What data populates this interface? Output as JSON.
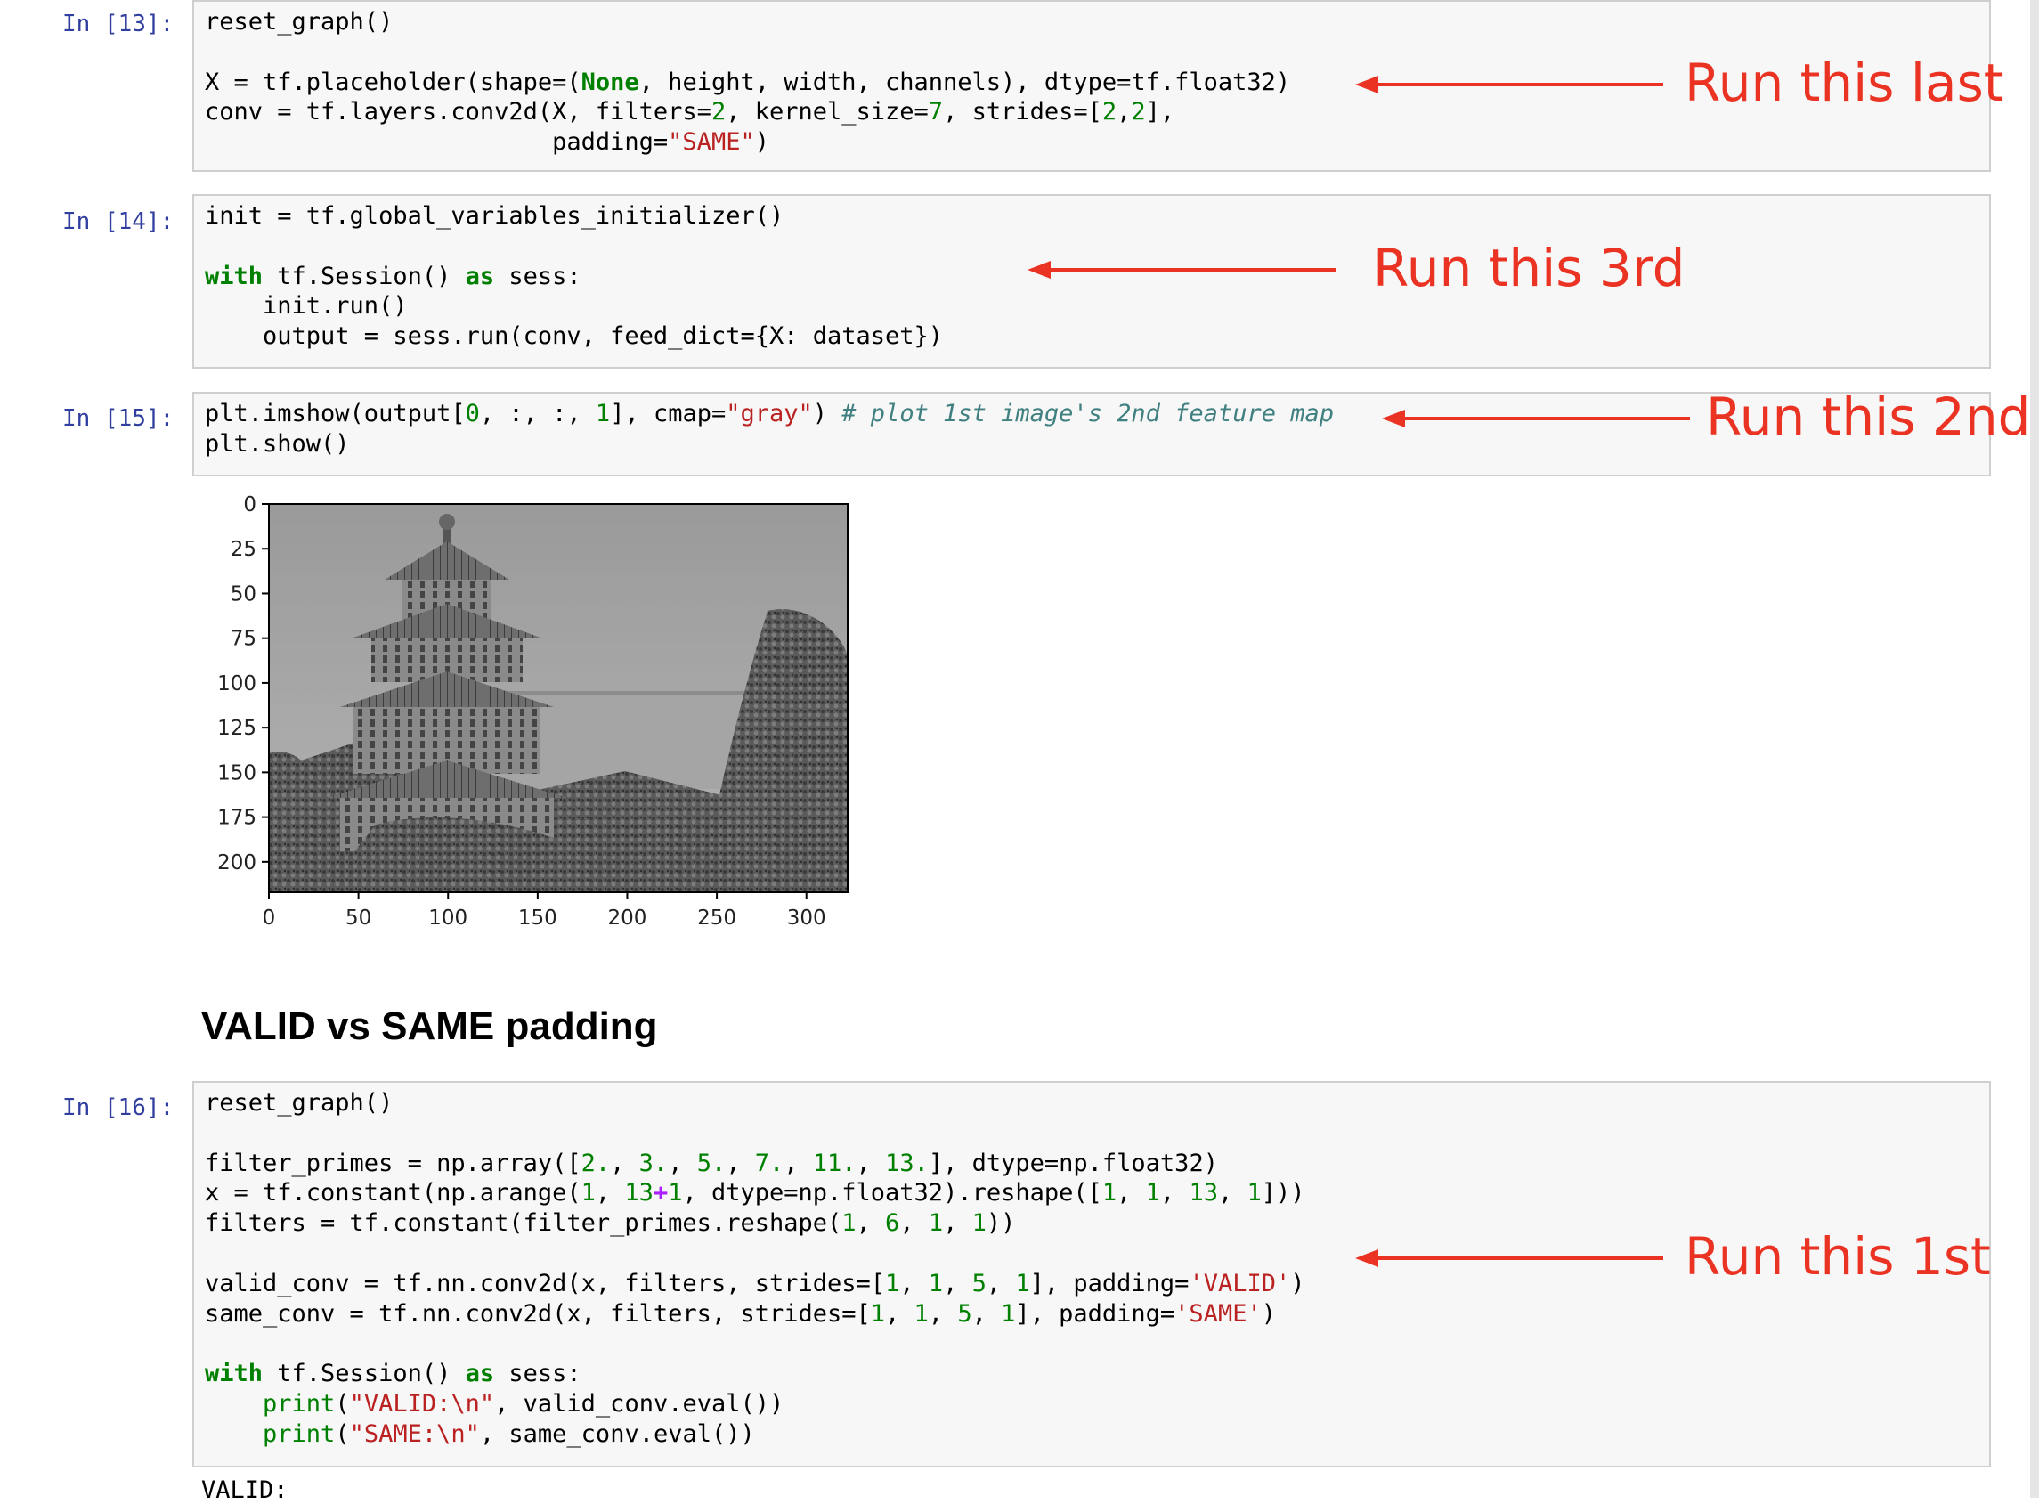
{
  "cells": [
    {
      "prompt": "In [13]:",
      "lines": [
        [
          {
            "t": "reset_graph()"
          }
        ],
        [],
        [
          {
            "t": "X = tf.placeholder(shape=("
          },
          {
            "t": "None",
            "c": "kw"
          },
          {
            "t": ", height, width, channels), dtype=tf.float32)"
          }
        ],
        [
          {
            "t": "conv = tf.layers.conv2d(X, filters="
          },
          {
            "t": "2",
            "c": "num"
          },
          {
            "t": ", kernel_size="
          },
          {
            "t": "7",
            "c": "num"
          },
          {
            "t": ", strides=["
          },
          {
            "t": "2",
            "c": "num"
          },
          {
            "t": ","
          },
          {
            "t": "2",
            "c": "num"
          },
          {
            "t": "],"
          }
        ],
        [
          {
            "t": "                        padding="
          },
          {
            "t": "\"SAME\"",
            "c": "str"
          },
          {
            "t": ")"
          }
        ]
      ]
    },
    {
      "prompt": "In [14]:",
      "lines": [
        [
          {
            "t": "init = tf.global_variables_initializer()"
          }
        ],
        [],
        [
          {
            "t": "with",
            "c": "kw"
          },
          {
            "t": " tf.Session() "
          },
          {
            "t": "as",
            "c": "kw"
          },
          {
            "t": " sess:"
          }
        ],
        [
          {
            "t": "    init.run()"
          }
        ],
        [
          {
            "t": "    output = sess.run(conv, feed_dict={X: dataset})"
          }
        ]
      ]
    },
    {
      "prompt": "In [15]:",
      "lines": [
        [
          {
            "t": "plt.imshow(output["
          },
          {
            "t": "0",
            "c": "num"
          },
          {
            "t": ", :, :, "
          },
          {
            "t": "1",
            "c": "num"
          },
          {
            "t": "], cmap="
          },
          {
            "t": "\"gray\"",
            "c": "str"
          },
          {
            "t": ") "
          },
          {
            "t": "# plot 1st image's 2nd feature map",
            "c": "cmt"
          }
        ],
        [
          {
            "t": "plt.show()"
          }
        ]
      ]
    },
    {
      "prompt": "In [16]:",
      "lines": [
        [
          {
            "t": "reset_graph()"
          }
        ],
        [],
        [
          {
            "t": "filter_primes = np.array(["
          },
          {
            "t": "2.",
            "c": "num"
          },
          {
            "t": ", "
          },
          {
            "t": "3.",
            "c": "num"
          },
          {
            "t": ", "
          },
          {
            "t": "5.",
            "c": "num"
          },
          {
            "t": ", "
          },
          {
            "t": "7.",
            "c": "num"
          },
          {
            "t": ", "
          },
          {
            "t": "11.",
            "c": "num"
          },
          {
            "t": ", "
          },
          {
            "t": "13.",
            "c": "num"
          },
          {
            "t": "], dtype=np.float32)"
          }
        ],
        [
          {
            "t": "x = tf.constant(np.arange("
          },
          {
            "t": "1",
            "c": "num"
          },
          {
            "t": ", "
          },
          {
            "t": "13",
            "c": "num"
          },
          {
            "t": "+",
            "c": "op"
          },
          {
            "t": "1",
            "c": "num"
          },
          {
            "t": ", dtype=np.float32).reshape(["
          },
          {
            "t": "1",
            "c": "num"
          },
          {
            "t": ", "
          },
          {
            "t": "1",
            "c": "num"
          },
          {
            "t": ", "
          },
          {
            "t": "13",
            "c": "num"
          },
          {
            "t": ", "
          },
          {
            "t": "1",
            "c": "num"
          },
          {
            "t": "]))"
          }
        ],
        [
          {
            "t": "filters = tf.constant(filter_primes.reshape("
          },
          {
            "t": "1",
            "c": "num"
          },
          {
            "t": ", "
          },
          {
            "t": "6",
            "c": "num"
          },
          {
            "t": ", "
          },
          {
            "t": "1",
            "c": "num"
          },
          {
            "t": ", "
          },
          {
            "t": "1",
            "c": "num"
          },
          {
            "t": "))"
          }
        ],
        [],
        [
          {
            "t": "valid_conv = tf.nn.conv2d(x, filters, strides=["
          },
          {
            "t": "1",
            "c": "num"
          },
          {
            "t": ", "
          },
          {
            "t": "1",
            "c": "num"
          },
          {
            "t": ", "
          },
          {
            "t": "5",
            "c": "num"
          },
          {
            "t": ", "
          },
          {
            "t": "1",
            "c": "num"
          },
          {
            "t": "], padding="
          },
          {
            "t": "'VALID'",
            "c": "str"
          },
          {
            "t": ")"
          }
        ],
        [
          {
            "t": "same_conv = tf.nn.conv2d(x, filters, strides=["
          },
          {
            "t": "1",
            "c": "num"
          },
          {
            "t": ", "
          },
          {
            "t": "1",
            "c": "num"
          },
          {
            "t": ", "
          },
          {
            "t": "5",
            "c": "num"
          },
          {
            "t": ", "
          },
          {
            "t": "1",
            "c": "num"
          },
          {
            "t": "], padding="
          },
          {
            "t": "'SAME'",
            "c": "str"
          },
          {
            "t": ")"
          }
        ],
        [],
        [
          {
            "t": "with",
            "c": "kw"
          },
          {
            "t": " tf.Session() "
          },
          {
            "t": "as",
            "c": "kw"
          },
          {
            "t": " sess:"
          }
        ],
        [
          {
            "t": "    "
          },
          {
            "t": "print",
            "c": "num"
          },
          {
            "t": "("
          },
          {
            "t": "\"VALID:\\n\"",
            "c": "str"
          },
          {
            "t": ", valid_conv.eval())"
          }
        ],
        [
          {
            "t": "    "
          },
          {
            "t": "print",
            "c": "num"
          },
          {
            "t": "("
          },
          {
            "t": "\"SAME:\\n\"",
            "c": "str"
          },
          {
            "t": ", same_conv.eval())"
          }
        ]
      ]
    }
  ],
  "annotations": {
    "last": "Run this last",
    "third": "Run this 3rd",
    "second": "Run this 2nd",
    "first": "Run this 1st"
  },
  "plot": {
    "yticks": [
      "0",
      "25",
      "50",
      "75",
      "100",
      "125",
      "150",
      "175",
      "200"
    ],
    "xticks": [
      "0",
      "50",
      "100",
      "150",
      "200",
      "250",
      "300"
    ],
    "image_description": "grayscale feature map of a pagoda on a hill"
  },
  "heading": "VALID vs SAME padding",
  "output_text": "VALID:",
  "colors": {
    "annotation": "#ea3323",
    "prompt": "#303f9f",
    "keyword": "#008000",
    "string": "#ba2121",
    "comment": "#408080"
  }
}
